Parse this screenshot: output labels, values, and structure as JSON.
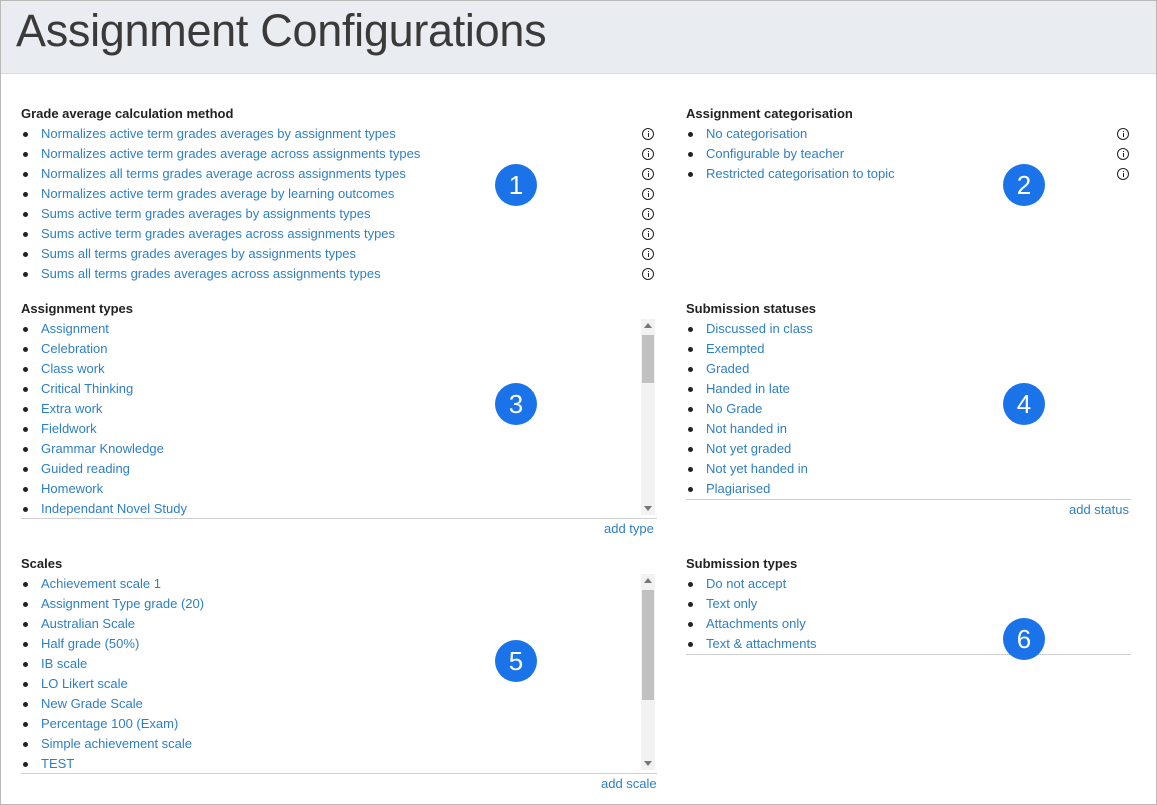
{
  "page": {
    "title": "Assignment Configurations"
  },
  "grade_average": {
    "title": "Grade average calculation method",
    "items": [
      "Normalizes active term grades averages by assignment types",
      "Normalizes active term grades average across assignments types",
      "Normalizes all terms grades average across assignments types",
      "Normalizes active term grades average by learning outcomes",
      "Sums active term grades averages by assignments types",
      "Sums active term grades averages across assignments types",
      "Sums all terms grades averages by assignments types",
      "Sums all terms grades averages across assignments types"
    ],
    "icon": "info-icon",
    "badge": "1"
  },
  "categorisation": {
    "title": "Assignment categorisation",
    "items": [
      "No categorisation",
      "Configurable by teacher",
      "Restricted categorisation to topic"
    ],
    "icon": "info-icon",
    "badge": "2"
  },
  "assignment_types": {
    "title": "Assignment types",
    "items": [
      "Assignment",
      "Celebration",
      "Class work",
      "Critical Thinking",
      "Extra work",
      "Fieldwork",
      "Grammar Knowledge",
      "Guided reading",
      "Homework",
      "Independant Novel Study"
    ],
    "add_label": "add type",
    "badge": "3"
  },
  "submission_statuses": {
    "title": "Submission statuses",
    "items": [
      "Discussed in class",
      "Exempted",
      "Graded",
      "Handed in late",
      "No Grade",
      "Not handed in",
      "Not yet graded",
      "Not yet handed in",
      "Plagiarised"
    ],
    "add_label": "add status",
    "badge": "4"
  },
  "scales": {
    "title": "Scales",
    "items": [
      "Achievement scale 1",
      "Assignment Type grade (20)",
      "Australian Scale",
      "Half grade (50%)",
      "IB scale",
      "LO Likert scale",
      "New Grade Scale",
      "Percentage 100 (Exam)",
      "Simple achievement scale",
      "TEST"
    ],
    "add_label": "add scale",
    "badge": "5"
  },
  "submission_types": {
    "title": "Submission types",
    "items": [
      "Do not accept",
      "Text only",
      "Attachments only",
      "Text & attachments"
    ],
    "badge": "6"
  },
  "colors": {
    "link": "#2d7fc5",
    "badge": "#1a73e8",
    "header_bg": "#e9ecf0"
  }
}
